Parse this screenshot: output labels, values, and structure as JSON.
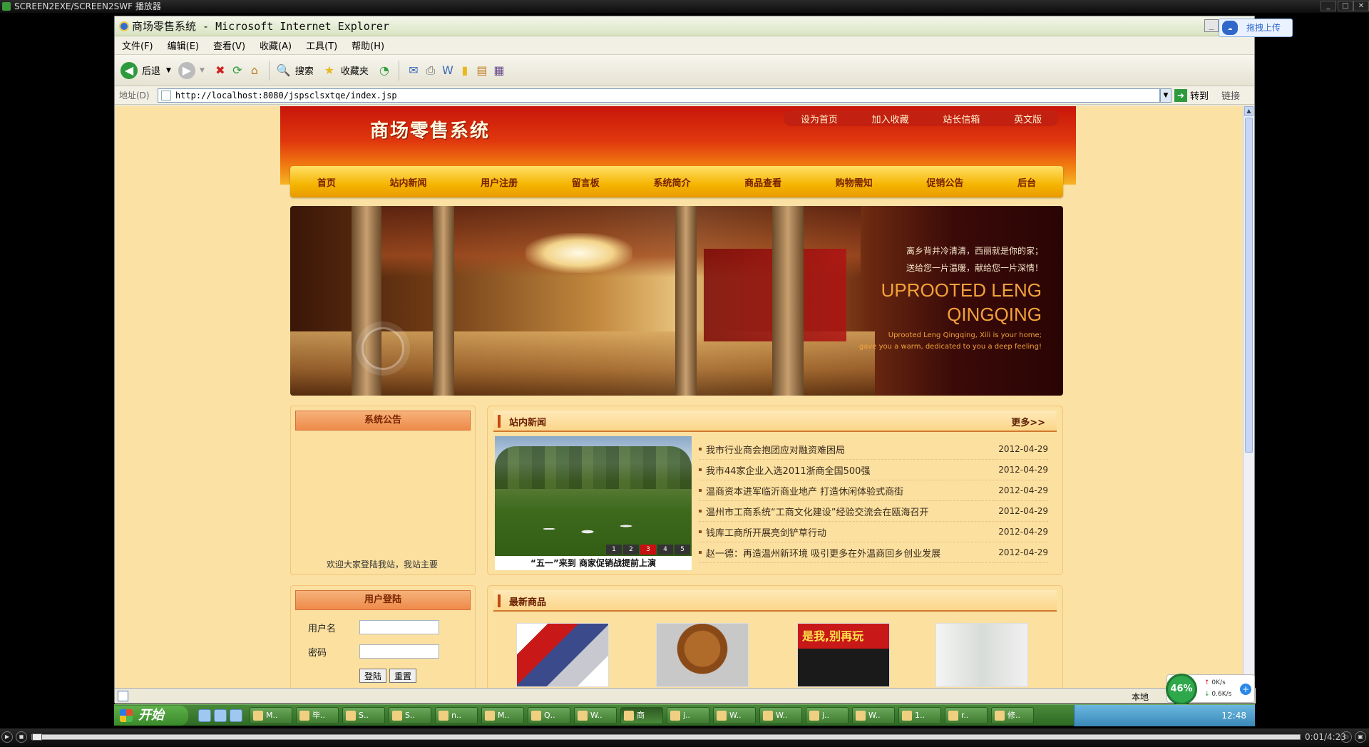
{
  "player": {
    "title": "SCREEN2EXE/SCREEN2SWF 播放器",
    "time": "0:01/4:23"
  },
  "ie": {
    "title": "商场零售系统 - Microsoft Internet Explorer",
    "baidu_upload": "拖拽上传",
    "menu": [
      "文件(F)",
      "编辑(E)",
      "查看(V)",
      "收藏(A)",
      "工具(T)",
      "帮助(H)"
    ],
    "toolbar": {
      "back": "后退",
      "search": "搜索",
      "favorites": "收藏夹"
    },
    "address": {
      "label": "地址(D)",
      "url": "http://localhost:8080/jspsclsxtqe/index.jsp",
      "go": "转到",
      "links": "链接"
    },
    "status_zone": "本地"
  },
  "site": {
    "title": "商场零售系统",
    "toplinks": [
      "设为首页",
      "加入收藏",
      "站长信箱",
      "英文版"
    ],
    "nav": [
      "首页",
      "站内新闻",
      "用户注册",
      "留言板",
      "系统简介",
      "商品查看",
      "购物需知",
      "促销公告",
      "后台"
    ],
    "banner": {
      "cn_line1": "离乡背井冷清清，西丽就是你的家；",
      "cn_line2": "送给您一片温暖，献给您一片深情！",
      "en_big1": "UPROOTED LENG",
      "en_big2": "QINGQING",
      "en_small1": "Uprooted Leng Qingqing, Xili is your home;",
      "en_small2": "gave you a warm, dedicated to you a deep feeling!"
    },
    "notice": {
      "title": "系统公告",
      "scroll_text": "欢迎大家登陆我站，我站主要"
    },
    "login": {
      "title": "用户登陆",
      "username_label": "用户名",
      "password_label": "密码",
      "login_btn": "登陆",
      "reset_btn": "重置"
    },
    "news": {
      "title": "站内新闻",
      "more": "更多>>",
      "photo_caption": "“五一”来到 商家促销战提前上演",
      "pager": [
        "1",
        "2",
        "3",
        "4",
        "5"
      ],
      "active_page": "3",
      "items": [
        {
          "title": "我市行业商会抱团应对融资难困局",
          "date": "2012-04-29"
        },
        {
          "title": "我市44家企业入选2011浙商全国500强",
          "date": "2012-04-29"
        },
        {
          "title": "温商资本进军临沂商业地产 打造休闲体验式商街",
          "date": "2012-04-29"
        },
        {
          "title": "温州市工商系统“工商文化建设”经验交流会在瓯海召开",
          "date": "2012-04-29"
        },
        {
          "title": "钱库工商所开展亮剑铲草行动",
          "date": "2012-04-29"
        },
        {
          "title": "赵一德：再造温州新环境 吸引更多在外温商回乡创业发展",
          "date": "2012-04-29"
        }
      ]
    },
    "products": {
      "title": "最新商品",
      "book_text": "是我,别再玩"
    }
  },
  "taskbar": {
    "start": "开始",
    "tasks": [
      "M..",
      "毕..",
      "S..",
      "S..",
      "n..",
      "M..",
      "Q..",
      "W..",
      "商",
      "j..",
      "W..",
      "W..",
      "j..",
      "W..",
      "1..",
      "r..",
      "修.."
    ],
    "active_task": "商",
    "clock": "12:48"
  },
  "netwidget": {
    "percent": "46%",
    "up": "0K/s",
    "down": "0.6K/s"
  }
}
